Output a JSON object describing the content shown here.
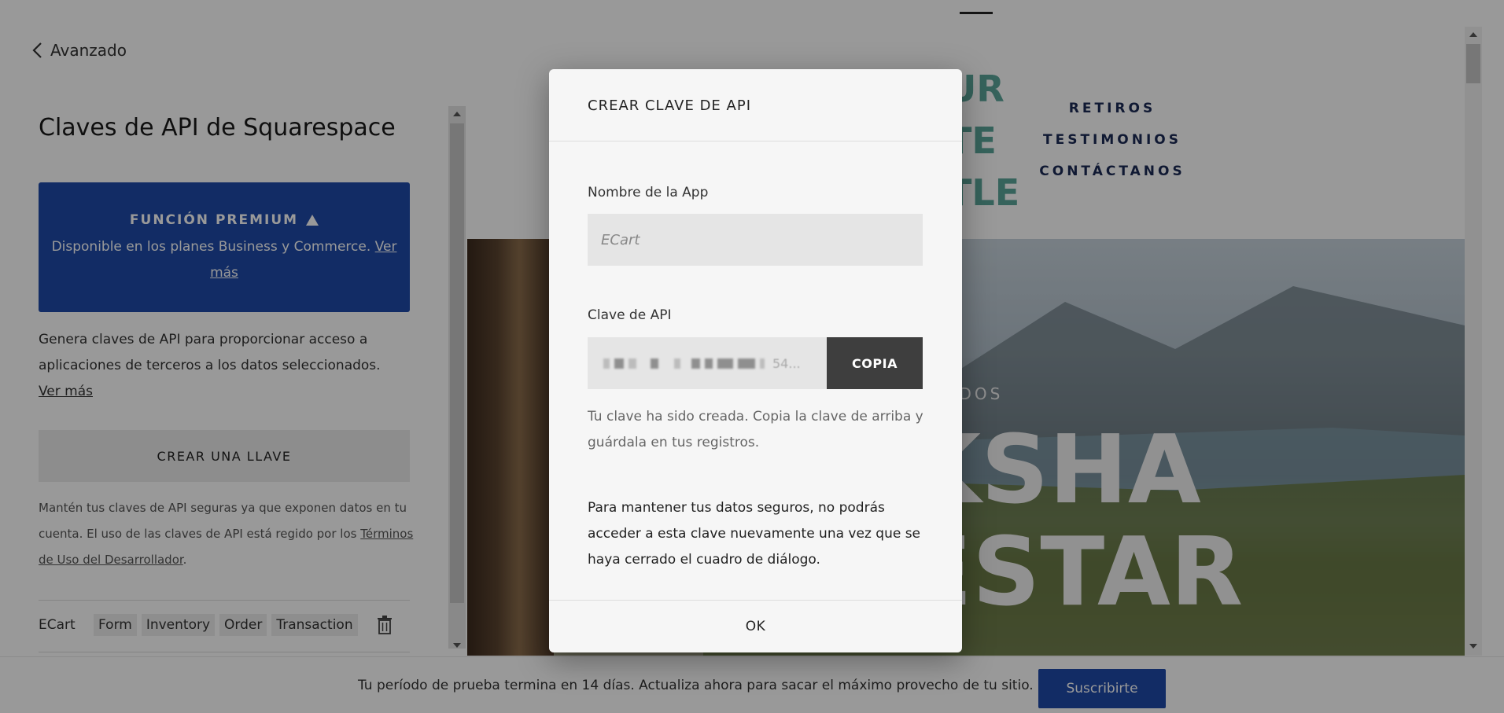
{
  "left_panel": {
    "back_label": "Avanzado",
    "title": "Claves de API de Squarespace",
    "premium": {
      "heading": "FUNCIÓN PREMIUM",
      "text": "Disponible en los planes Business y Commerce.",
      "more": "Ver más"
    },
    "description": {
      "text": "Genera claves de API para proporcionar acceso a aplicaciones de terceros a los datos seleccionados.",
      "more": "Ver más"
    },
    "create_button": "CREAR UNA LLAVE",
    "legal": {
      "text": "Mantén tus claves de API seguras ya que exponen datos en tu cuenta. El uso de las claves de API está regido por los",
      "link": "Términos de Uso del Desarrollador",
      "end": "."
    },
    "keys": [
      {
        "name": "ECart",
        "scopes": [
          "Form",
          "Inventory",
          "Order",
          "Transaction"
        ]
      }
    ]
  },
  "preview": {
    "logo_lines": [
      "UR",
      "TE",
      "TLE"
    ],
    "nav": [
      "RETIROS",
      "TESTIMONIOS",
      "CONTÁCTANOS"
    ],
    "hero_subtitle": "ENIDOS",
    "hero_lines": [
      "KSHA",
      "ESTAR"
    ]
  },
  "modal": {
    "title": "CREAR CLAVE DE API",
    "name_label": "Nombre de la App",
    "name_placeholder": "ECart",
    "key_label": "Clave de API",
    "key_tail": "54...",
    "copy_button": "COPIA",
    "help": "Tu clave ha sido creada. Copia la clave de arriba y guárdala en tus registros.",
    "warning": "Para mantener tus datos seguros, no podrás acceder a esta clave nuevamente una vez que se haya cerrado el cuadro de diálogo.",
    "ok_button": "OK"
  },
  "bottom_bar": {
    "trial_text": "Tu período de prueba termina en 14 días. Actualiza ahora para sacar el máximo provecho de tu sitio.",
    "subscribe": "Suscribirte"
  },
  "colors": {
    "brand_blue": "#1e4aa8",
    "accent_teal": "#5aa69a",
    "nav_navy": "#1c2a55",
    "copy_button": "#3e3e3e"
  },
  "icons": {
    "back": "chevron-left-icon",
    "premium": "arrow-up-icon",
    "delete": "trash-icon"
  }
}
